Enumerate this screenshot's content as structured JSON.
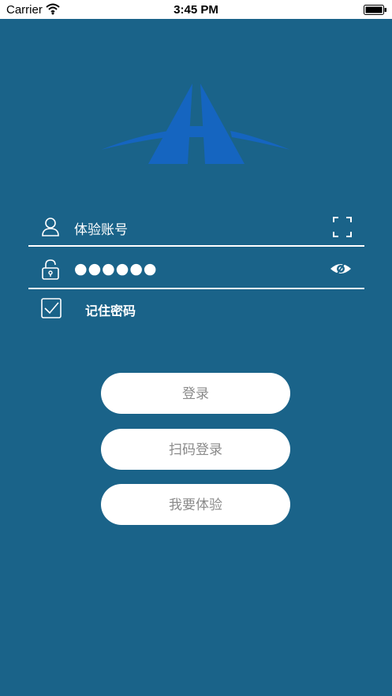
{
  "status_bar": {
    "carrier": "Carrier",
    "time": "3:45 PM",
    "wifi_icon": "wifi-icon",
    "battery_icon": "battery-icon"
  },
  "logo": {
    "icon": "road-logo-icon"
  },
  "login_form": {
    "account_value": "体验账号",
    "account_icon": "user-icon",
    "scan_icon": "scan-icon",
    "password_value": "●●●●●●",
    "password_icon": "lock-icon",
    "toggle_visibility_icon": "eye-icon",
    "remember_label": "记住密码",
    "remember_checked": true
  },
  "buttons": {
    "login": "登录",
    "scan_login": "扫码登录",
    "trial": "我要体验"
  },
  "colors": {
    "background": "#1a6389",
    "logo_blue": "#1565c0",
    "button_bg": "#ffffff",
    "button_text": "#8a8a8a"
  }
}
